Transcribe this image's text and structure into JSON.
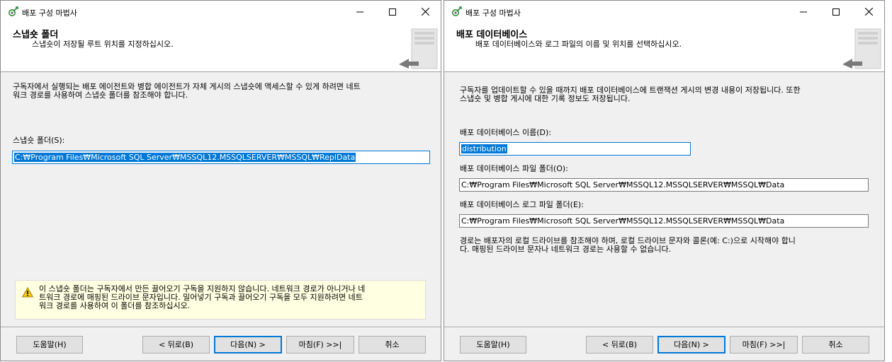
{
  "left": {
    "title": "배포 구성 마법사",
    "header_title": "스냅숏 폴더",
    "header_subtitle": "스냅숏이 저장될 루트 위치를 지정하십시오.",
    "description_line1": "구독자에서 실행되는 배포 에이전트와 병합 에이전트가 자체 게시의 스냅숏에 액세스할 수 있게 하려면 네트",
    "description_line2": "워크 경로를 사용하여 스냅숏 폴더를 참조해야 합니다.",
    "snapshot_label": "스냅숏 폴더(S):",
    "snapshot_value": "C:₩Program Files₩Microsoft SQL Server₩MSSQL12.MSSQLSERVER₩MSSQL₩ReplData",
    "warning_line1": "이 스냅숏 폴더는 구독자에서 만든 끌어오기 구독을 지원하지 않습니다. 네트워크 경로가 아니거나 네",
    "warning_line2": "트워크 경로에 매핑된 드라이브 문자입니다. 밀어넣기 구독과 끌어오기 구독을 모두 지원하려면 네트",
    "warning_line3": "워크 경로를 사용하여 이 폴더를 참조하십시오.",
    "buttons": {
      "help": "도움말(H)",
      "back": "< 뒤로(B)",
      "next": "다음(N) >",
      "finish": "마침(F) >>|",
      "cancel": "취소"
    }
  },
  "right": {
    "title": "배포 구성 마법사",
    "header_title": "배포 데이터베이스",
    "header_subtitle": "배포 데이터베이스와 로그 파일의 이름 및 위치를 선택하십시오.",
    "description_line1": "구독자를 업데이트할 수 있을 때까지 배포 데이터베이스에 트랜잭션 게시의 변경 내용이 저장됩니다. 또한",
    "description_line2": "스냅숏 및 병합 게시에 대한 기록 정보도 저장됩니다.",
    "db_name_label": "배포 데이터베이스 이름(D):",
    "db_name_value": "distribution",
    "db_folder_label": "배포 데이터베이스 파일 폴더(O):",
    "db_folder_value": "C:₩Program Files₩Microsoft SQL Server₩MSSQL12.MSSQLSERVER₩MSSQL₩Data",
    "log_folder_label": "배포 데이터베이스 로그 파일 폴더(E):",
    "log_folder_value": "C:₩Program Files₩Microsoft SQL Server₩MSSQL12.MSSQLSERVER₩MSSQL₩Data",
    "note_line1": "경로는 배포자의 로컬 드라이브를 참조해야 하며, 로컬 드라이브 문자와 콜론(예: C:)으로 시작해야 합니",
    "note_line2": "다. 매핑된 드라이브 문자나 네트워크 경로는 사용할 수 없습니다.",
    "buttons": {
      "help": "도움말(H)",
      "back": "< 뒤로(B)",
      "next": "다음(N) >",
      "finish": "마침(F) >>|",
      "cancel": "취소"
    }
  },
  "icons": {
    "app": "wizard-icon",
    "minimize": "minimize-icon",
    "maximize": "maximize-icon",
    "close": "close-icon",
    "warning": "warning-icon",
    "header": "server-graphic-icon"
  },
  "colors": {
    "accent": "#0078d7",
    "dialog_bg": "#f0f0f0",
    "warning_bg": "#ffffe1"
  }
}
